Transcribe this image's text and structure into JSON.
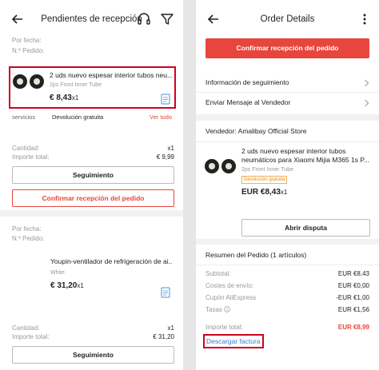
{
  "left": {
    "header": {
      "title": "Pendientes de recepción"
    },
    "order1": {
      "fecha_label": "Por fecha:",
      "pedido_label": "N.º Pedido:",
      "product_title": "2 uds nuevo espesar interior tubos neu...",
      "variant": "2ps Front Inner Tube",
      "price": "€ 8,43",
      "qty": "x1",
      "service_label": "servicios",
      "service_value": "Devolución gratuita",
      "see_all": "Ver todo",
      "cantidad_label": "Cantidad:",
      "cantidad_value": "x1",
      "importe_label": "Importe total:",
      "importe_value": "€ 9,99",
      "tracking_button": "Seguimiento",
      "confirm_button": "Confirmar recepción del pedido"
    },
    "order2": {
      "fecha_label": "Por fecha:",
      "pedido_label": "N.º Pedido:",
      "product_title": "Youpin-ventilador de refrigeración de ai...",
      "variant": "White",
      "price": "€ 31,20",
      "qty": "x1",
      "cantidad_label": "Cantidad:",
      "cantidad_value": "x1",
      "importe_label": "Importe total:",
      "importe_value": "€ 31,20",
      "tracking_button": "Seguimiento"
    }
  },
  "right": {
    "header": {
      "title": "Order Details"
    },
    "confirm_button": "Confirmar recepción del pedido",
    "menu": [
      {
        "label": "Información de seguimiento"
      },
      {
        "label": "Enviar Mensaje al Vendedor"
      }
    ],
    "seller": "Vendedor: Amalibay Official Store",
    "product_title": "2 uds nuevo espesar interior tubos neumáticos para Xiaomi Mijia M365 1s P...",
    "variant": "2ps Front Inner Tube",
    "badge": "Devolución gratuita",
    "price": "EUR €8,43",
    "qty": "x1",
    "dispute_button": "Abrir disputa",
    "summary": {
      "title": "Resumen del Pedido (1 artículos)",
      "rows": [
        {
          "label": "Subtotal:",
          "value": "EUR €8,43"
        },
        {
          "label": "Costes de envío:",
          "value": "EUR €0,00"
        },
        {
          "label": "Cupón AliExpress",
          "value": "-EUR €1,00"
        },
        {
          "label": "Tasas",
          "value": "EUR €1,56"
        }
      ],
      "total_label": "Importe total:",
      "total_value": "EUR €8,99",
      "invoice_link": "Descargar factura"
    }
  },
  "colors": {
    "accent": "#e8453c",
    "highlight_box": "#d0021b"
  },
  "icons": [
    "back-arrow-icon",
    "headset-icon",
    "filter-icon",
    "more-dots-icon",
    "invoice-icon",
    "chevron-right-icon",
    "info-icon"
  ]
}
